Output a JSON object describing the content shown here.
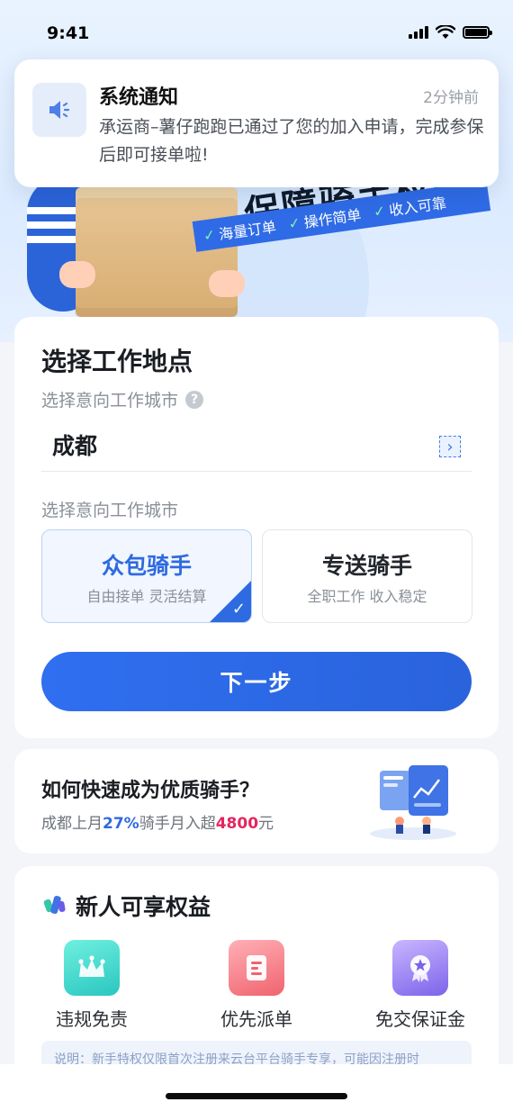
{
  "status_bar": {
    "time": "9:41"
  },
  "banner": {
    "title": "保障骑手权益",
    "features": [
      "海量订单",
      "操作简单",
      "收入可靠"
    ]
  },
  "notification": {
    "icon": "speaker-icon",
    "title": "系统通知",
    "time": "2分钟前",
    "body": "承运商–薯仔跑跑已通过了您的加入申请，完成参保后即可接单啦!"
  },
  "location": {
    "title": "选择工作地点",
    "city_hint": "选择意向工作城市",
    "city_value": "成都",
    "type_hint": "选择意向工作城市",
    "options": [
      {
        "title": "众包骑手",
        "subtitle": "自由接单 灵活结算",
        "selected": true
      },
      {
        "title": "专送骑手",
        "subtitle": "全职工作 收入稳定",
        "selected": false
      }
    ],
    "next_label": "下一步"
  },
  "tips": {
    "title": "如何快速成为优质骑手？",
    "sub_prefix": "成都上月",
    "percent": "27%",
    "sub_mid": "骑手月入超",
    "amount": "4800",
    "sub_suffix": "元"
  },
  "benefits": {
    "title": "新人可享权益",
    "items": [
      {
        "label": "违规免责",
        "icon": "crown-icon"
      },
      {
        "label": "优先派单",
        "icon": "document-icon"
      },
      {
        "label": "免交保证金",
        "icon": "badge-star-icon"
      }
    ],
    "note": "说明：新手特权仅限首次注册来云台平台骑手专享，可能因注册时"
  },
  "colors": {
    "primary": "#2e6ae0",
    "accent_red": "#e5255e"
  }
}
